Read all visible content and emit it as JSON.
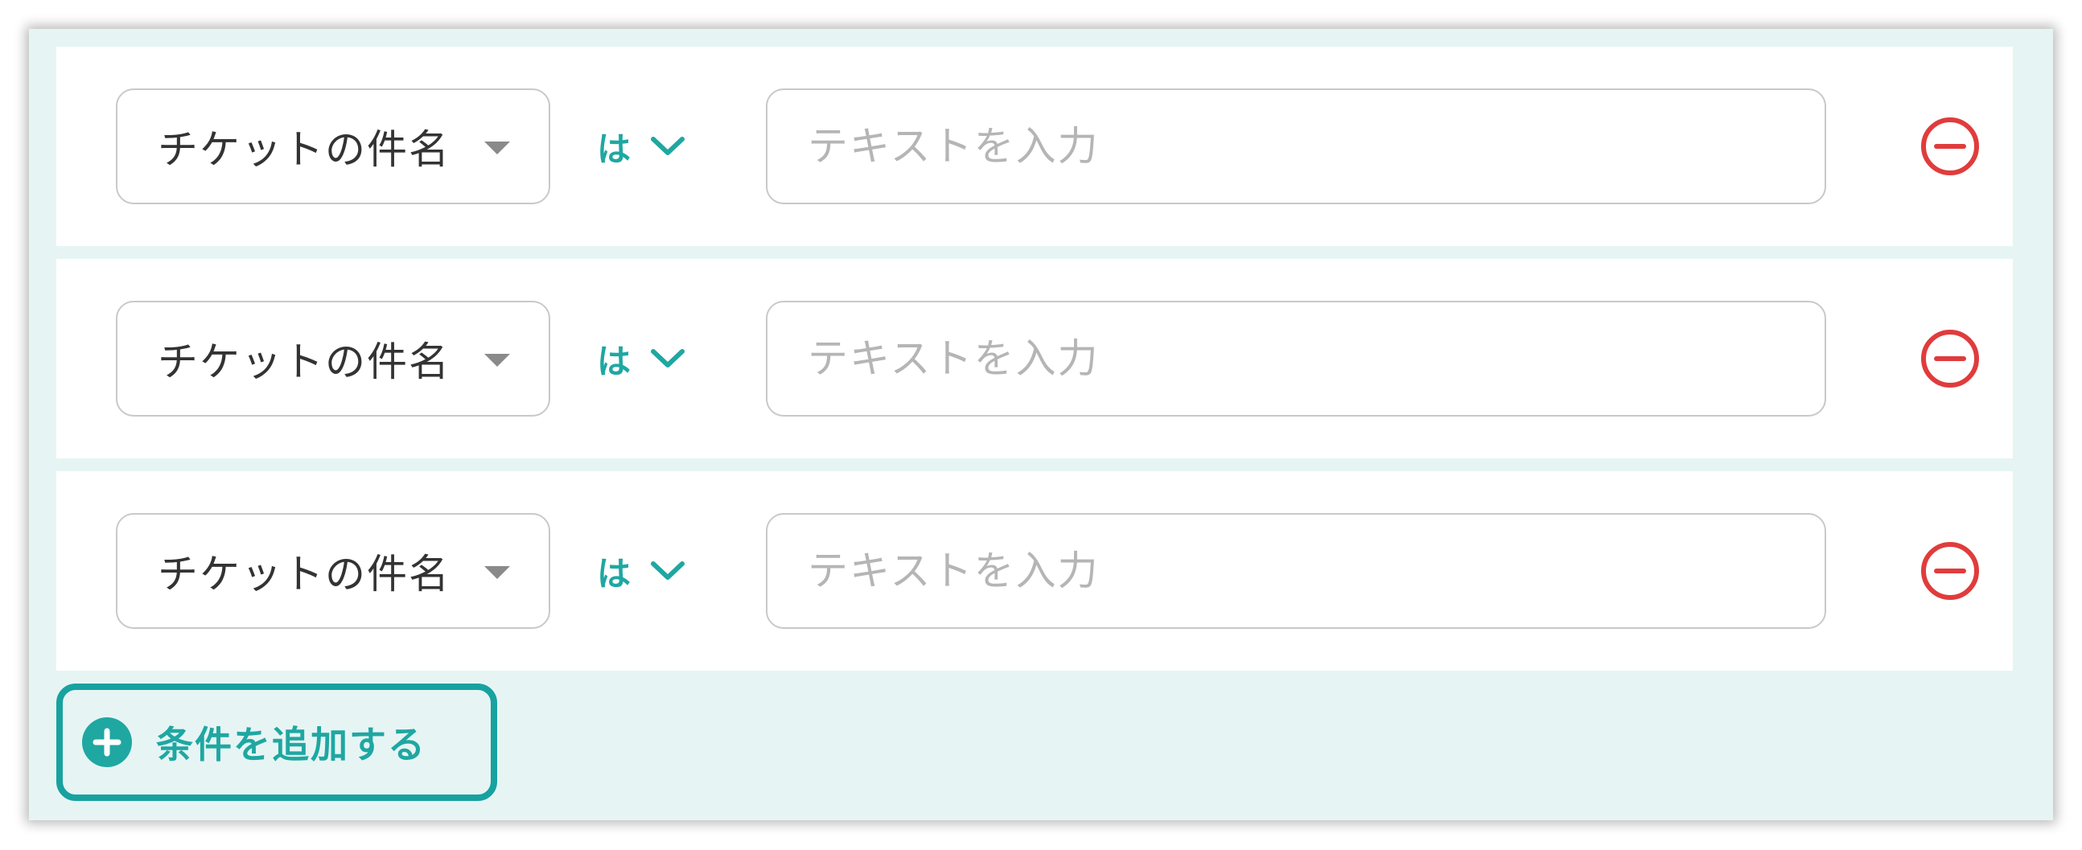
{
  "conditions": [
    {
      "field": "チケットの件名",
      "operator": "は",
      "value": "",
      "placeholder": "テキストを入力"
    },
    {
      "field": "チケットの件名",
      "operator": "は",
      "value": "",
      "placeholder": "テキストを入力"
    },
    {
      "field": "チケットの件名",
      "operator": "は",
      "value": "",
      "placeholder": "テキストを入力"
    }
  ],
  "add_button": {
    "label": "条件を追加する",
    "icon": "plus-circle-icon"
  },
  "icons": {
    "field_caret": "caret-down-icon",
    "operator_chevron": "chevron-down-icon",
    "remove": "minus-circle-icon"
  },
  "colors": {
    "accent": "#1fa7a2",
    "highlight_border": "#17a2a0",
    "remove": "#e03c3c",
    "panel_background": "#e6f5f4"
  }
}
